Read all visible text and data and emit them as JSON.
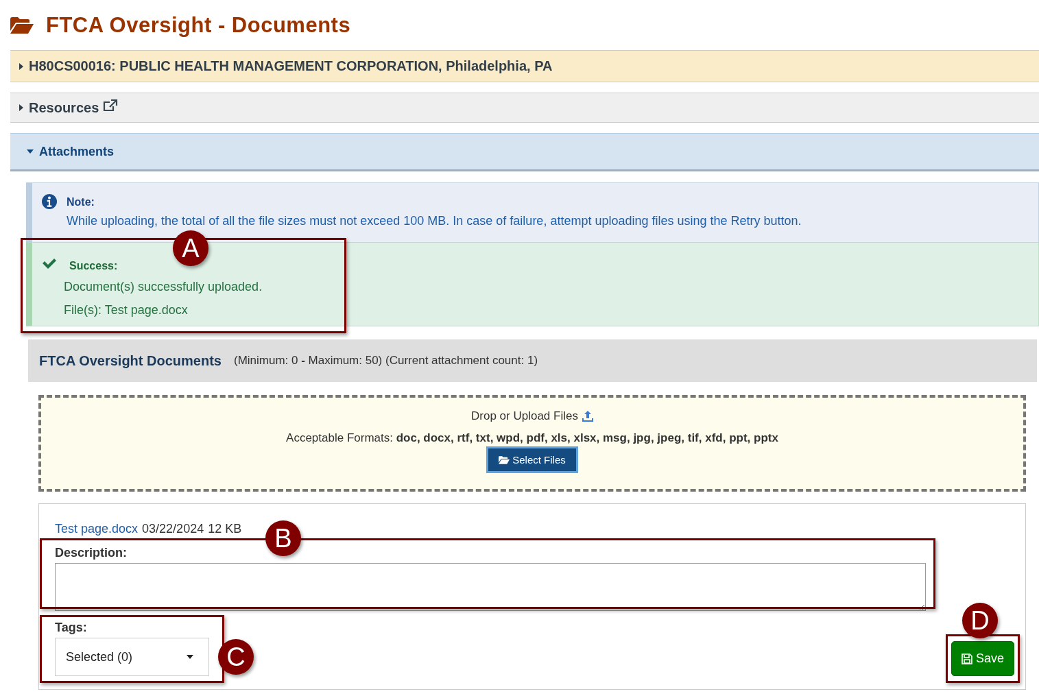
{
  "page": {
    "title": "FTCA Oversight - Documents"
  },
  "accordions": [
    {
      "kind": "org",
      "label": "H80CS00016: PUBLIC HEALTH MANAGEMENT CORPORATION, Philadelphia, PA",
      "expanded": false,
      "external_link": false
    },
    {
      "kind": "plain",
      "label": "Resources",
      "expanded": false,
      "external_link": true
    },
    {
      "kind": "active",
      "label": "Attachments",
      "expanded": true,
      "external_link": false
    }
  ],
  "alerts": [
    {
      "kind": "info",
      "title": "Note:",
      "lines": [
        "While uploading, the total of all the file sizes must not exceed 100 MB. In case of failure, attempt uploading files using the Retry button."
      ]
    },
    {
      "kind": "success",
      "title": "Success:",
      "lines": [
        "Document(s) successfully uploaded.",
        "File(s): Test page.docx"
      ]
    }
  ],
  "section": {
    "title": "FTCA Oversight Documents",
    "meta": "(Minimum: 0 **-** Maximum: 50) (Current attachment count: 1)"
  },
  "dropzone": {
    "prompt": "Drop or Upload Files",
    "formats": "Acceptable Formats: **doc, docx, rtf, txt, wpd, pdf, xls, xlsx, msg, jpg, jpeg, tif, xfd, ppt, pptx**",
    "button": "Select Files"
  },
  "file": {
    "name": "Test page.docx",
    "date": "03/22/2024",
    "size": "12 KB",
    "description_label": "Description:",
    "tags_label": "Tags:",
    "tags_value": "Selected (0)",
    "save": "Save"
  },
  "callouts": [
    {
      "letter": "A"
    },
    {
      "letter": "B"
    },
    {
      "letter": "C"
    },
    {
      "letter": "D"
    }
  ]
}
